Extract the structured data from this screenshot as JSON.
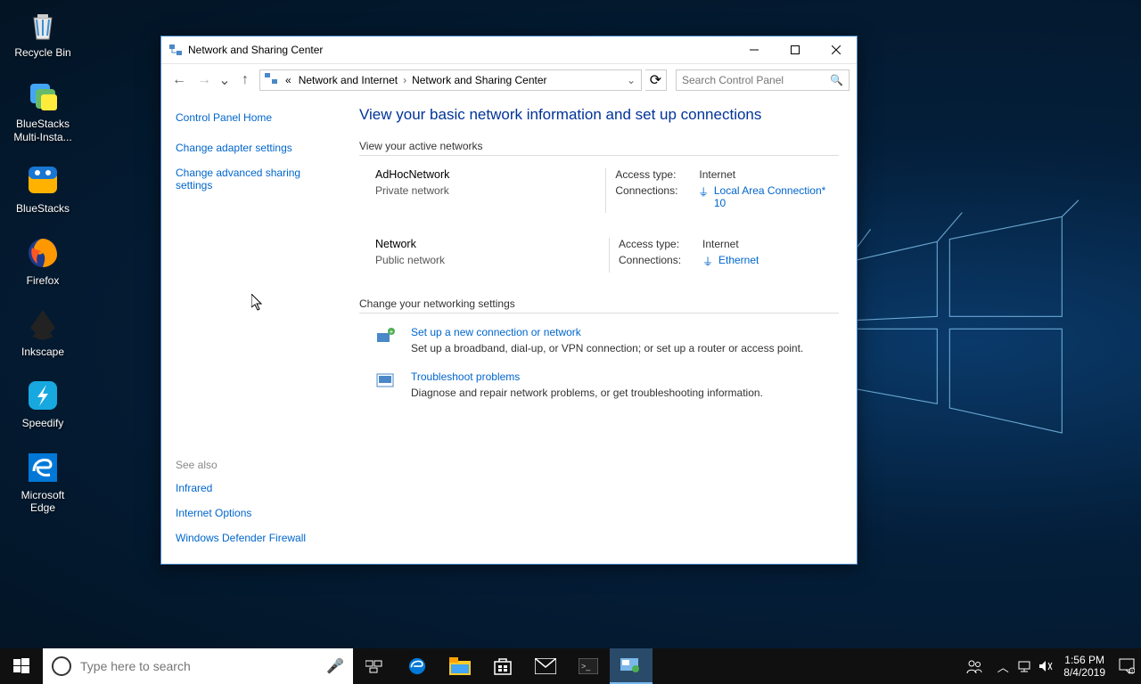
{
  "desktop": {
    "icons": [
      {
        "label": "Recycle Bin"
      },
      {
        "label": "BlueStacks Multi-Insta..."
      },
      {
        "label": "BlueStacks"
      },
      {
        "label": "Firefox"
      },
      {
        "label": "Inkscape"
      },
      {
        "label": "Speedify"
      },
      {
        "label": "Microsoft Edge"
      }
    ]
  },
  "window": {
    "title": "Network and Sharing Center",
    "breadcrumb": {
      "prefix": "«",
      "seg1": "Network and Internet",
      "seg2": "Network and Sharing Center"
    },
    "search_placeholder": "Search Control Panel",
    "sidebar": {
      "home": "Control Panel Home",
      "links": [
        "Change adapter settings",
        "Change advanced sharing settings"
      ],
      "see_also_label": "See also",
      "see_also": [
        "Infrared",
        "Internet Options",
        "Windows Defender Firewall"
      ]
    },
    "main": {
      "heading": "View your basic network information and set up connections",
      "active_networks_label": "View your active networks",
      "networks": [
        {
          "name": "AdHocNetwork",
          "type": "Private network",
          "access_label": "Access type:",
          "access_value": "Internet",
          "conn_label": "Connections:",
          "conn_link": "Local Area Connection* 10"
        },
        {
          "name": "Network",
          "type": "Public network",
          "access_label": "Access type:",
          "access_value": "Internet",
          "conn_label": "Connections:",
          "conn_link": "Ethernet"
        }
      ],
      "change_settings_label": "Change your networking settings",
      "actions": [
        {
          "title": "Set up a new connection or network",
          "desc": "Set up a broadband, dial-up, or VPN connection; or set up a router or access point."
        },
        {
          "title": "Troubleshoot problems",
          "desc": "Diagnose and repair network problems, or get troubleshooting information."
        }
      ]
    }
  },
  "taskbar": {
    "search_placeholder": "Type here to search",
    "time": "1:56 PM",
    "date": "8/4/2019"
  }
}
